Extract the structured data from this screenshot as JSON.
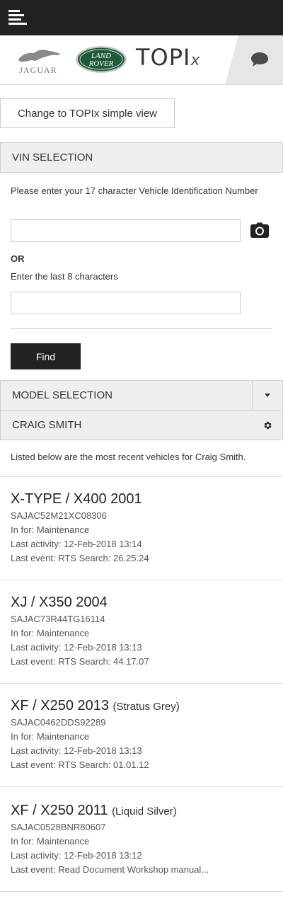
{
  "header": {
    "menu_icon": "hamburger-menu-icon",
    "brands": {
      "jaguar": "JAGUAR",
      "land_rover_line1": "LAND",
      "land_rover_line2": "ROVER",
      "topix_main": "TOPI",
      "topix_suffix": "x"
    },
    "chat_icon": "chat-bubble-icon"
  },
  "simple_view_button": "Change to TOPIx simple view",
  "vin_selection": {
    "title": "VIN SELECTION",
    "prompt": "Please enter your 17 character Vehicle Identification Number",
    "vin_value": "",
    "camera_icon": "camera-icon",
    "or_label": "OR",
    "last8_label": "Enter the last 8 characters",
    "last8_value": "",
    "find_button": "Find"
  },
  "model_selection": {
    "title": "MODEL SELECTION",
    "dropdown_icon": "caret-down-icon"
  },
  "user_section": {
    "title": "CRAIG SMITH",
    "settings_icon": "gear-icon",
    "intro": "Listed below are the most recent vehicles for Craig Smith."
  },
  "vehicles": [
    {
      "title": "X-TYPE / X400 2001",
      "color": "",
      "vin": "SAJAC52M21XC08306",
      "in_for": "In for: Maintenance",
      "last_activity": "Last activity: 12-Feb-2018 13:14",
      "last_event": "Last event: RTS Search: 26.25.24"
    },
    {
      "title": "XJ / X350 2004",
      "color": "",
      "vin": "SAJAC73R44TG16114",
      "in_for": "In for: Maintenance",
      "last_activity": "Last activity: 12-Feb-2018 13:13",
      "last_event": "Last event: RTS Search: 44.17.07"
    },
    {
      "title": "XF / X250 2013",
      "color": "(Stratus Grey)",
      "vin": "SAJAC0462DDS92289",
      "in_for": "In for: Maintenance",
      "last_activity": "Last activity: 12-Feb-2018 13:13",
      "last_event": "Last event: RTS Search: 01.01.12"
    },
    {
      "title": "XF / X250 2011",
      "color": "(Liquid Silver)",
      "vin": "SAJAC0528BNR80607",
      "in_for": "In for: Maintenance",
      "last_activity": "Last activity: 12-Feb-2018 13:12",
      "last_event": "Last event: Read Document Workshop manual..."
    }
  ],
  "colors": {
    "topbar": "#212121",
    "section_header_bg": "#efefef",
    "find_button_bg": "#222222",
    "land_rover_green": "#1f5a3a"
  }
}
